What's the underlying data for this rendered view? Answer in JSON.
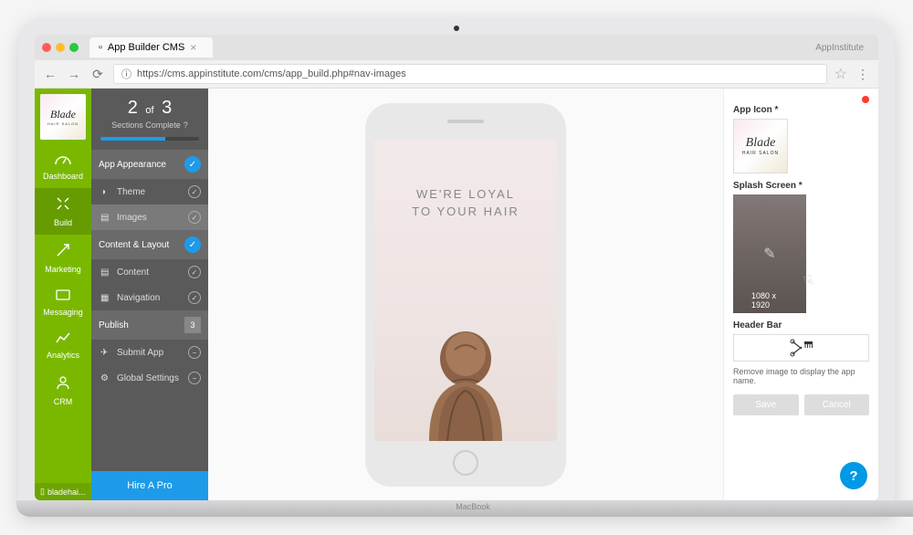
{
  "browser": {
    "tab_title": "App Builder CMS",
    "brand": "AppInstitute",
    "url": "https://cms.appinstitute.com/cms/app_build.php#nav-images"
  },
  "logo": {
    "title": "Blade",
    "subtitle": "HAIR SALON"
  },
  "nav": {
    "items": [
      {
        "label": "Dashboard",
        "icon": "◷"
      },
      {
        "label": "Build",
        "icon": "✕"
      },
      {
        "label": "Marketing",
        "icon": "⟋"
      },
      {
        "label": "Messaging",
        "icon": "✉"
      },
      {
        "label": "Analytics",
        "icon": "〜"
      },
      {
        "label": "CRM",
        "icon": "☺"
      }
    ],
    "footer": "bladehai..."
  },
  "progress": {
    "current": "2",
    "of": "of",
    "total": "3",
    "label": "Sections Complete"
  },
  "sections": [
    {
      "title": "App Appearance",
      "status": "done",
      "items": [
        {
          "label": "Theme",
          "icon": "◑",
          "status": "done"
        },
        {
          "label": "Images",
          "icon": "▤",
          "status": "done",
          "active": true
        }
      ]
    },
    {
      "title": "Content & Layout",
      "status": "done",
      "items": [
        {
          "label": "Content",
          "icon": "▤",
          "status": "done"
        },
        {
          "label": "Navigation",
          "icon": "▦",
          "status": "done"
        }
      ]
    },
    {
      "title": "Publish",
      "status": "count",
      "count": "3",
      "items": [
        {
          "label": "Submit App",
          "icon": "✈",
          "status": "minus"
        },
        {
          "label": "Global Settings",
          "icon": "⚙",
          "status": "minus"
        }
      ]
    }
  ],
  "hire_label": "Hire A Pro",
  "splash": {
    "line1": "WE'RE LOYAL",
    "line2": "TO YOUR HAIR"
  },
  "panel": {
    "app_icon_label": "App Icon *",
    "splash_label": "Splash Screen *",
    "splash_dims": "1080 x 1920",
    "header_label": "Header Bar",
    "hint": "Remove image to display the app name.",
    "save": "Save",
    "cancel": "Cancel"
  }
}
